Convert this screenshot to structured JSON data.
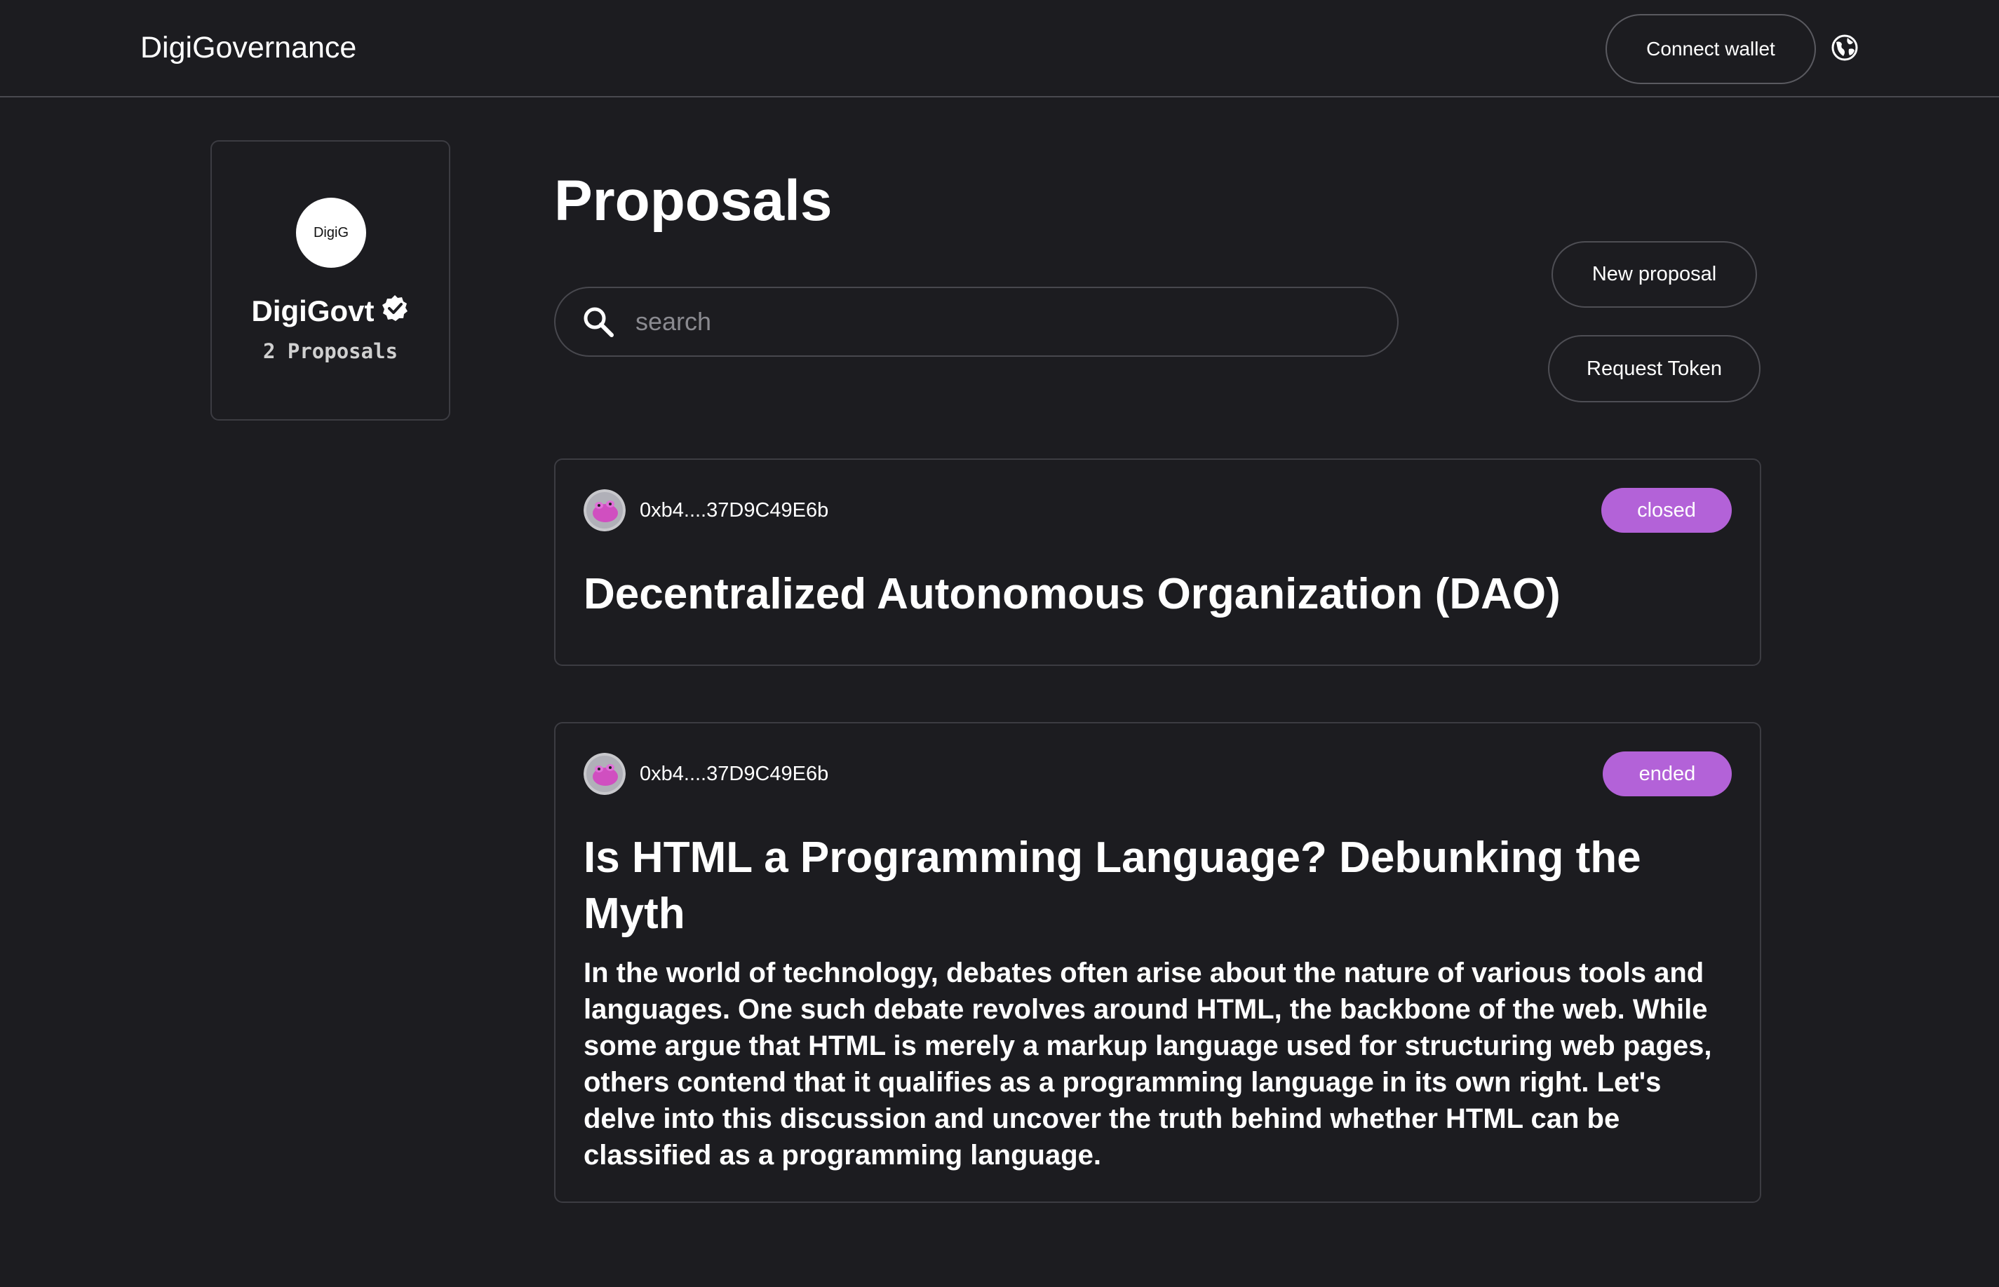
{
  "header": {
    "brand": "DigiGovernance",
    "connect_label": "Connect wallet",
    "globe_icon": "globe-icon"
  },
  "space": {
    "avatar_text": "DigiG",
    "name": "DigiGovt",
    "verified_icon": "verified-badge-icon",
    "proposal_count": "2 Proposals"
  },
  "main": {
    "title": "Proposals",
    "search": {
      "placeholder": "search",
      "value": ""
    },
    "new_proposal_label": "New proposal",
    "request_token_label": "Request Token"
  },
  "proposals": [
    {
      "author": "0xb4....37D9C49E6b",
      "state": "closed",
      "title": "Decentralized Autonomous Organization (DAO)",
      "body": ""
    },
    {
      "author": "0xb4....37D9C49E6b",
      "state": "ended",
      "title": "Is HTML a Programming Language? Debunking the Myth",
      "body": "In the world of technology, debates often arise about the nature of various tools and languages. One such debate revolves around HTML, the backbone of the web. While some argue that HTML is merely a markup language used for structuring web pages, others contend that it qualifies as a programming language in its own right. Let's delve into this discussion and uncover the truth behind whether HTML can be classified as a programming language."
    }
  ],
  "colors": {
    "background": "#1c1c20",
    "badge": "#b362d8",
    "border": "#3c3c42"
  }
}
